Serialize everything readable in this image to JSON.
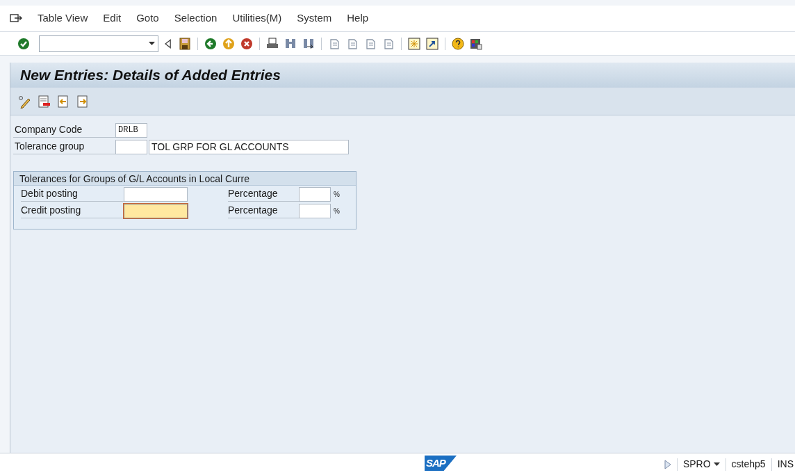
{
  "menu": [
    {
      "label": "Table View"
    },
    {
      "label": "Edit"
    },
    {
      "label": "Goto"
    },
    {
      "label": "Selection"
    },
    {
      "label": "Utilities(M)"
    },
    {
      "label": "System"
    },
    {
      "label": "Help"
    }
  ],
  "title": "New Entries: Details of Added Entries",
  "header_fields": [
    {
      "label": "Company Code",
      "value": "DRLB",
      "kind": "code"
    },
    {
      "label": "Tolerance group",
      "description": "TOL GRP FOR GL ACCOUNTS",
      "kind": "with_description"
    }
  ],
  "group_box": {
    "title": "Tolerances for Groups of G/L Accounts in Local Curre",
    "rows": [
      {
        "label": "Debit posting",
        "focused": false,
        "percent_label": "Percentage",
        "unit": "%"
      },
      {
        "label": "Credit posting",
        "focused": true,
        "percent_label": "Percentage",
        "unit": "%"
      }
    ]
  },
  "status_bar": {
    "logo_text": "SAP",
    "transaction": "SPRO",
    "server": "cstehp5",
    "mode": "INS"
  }
}
